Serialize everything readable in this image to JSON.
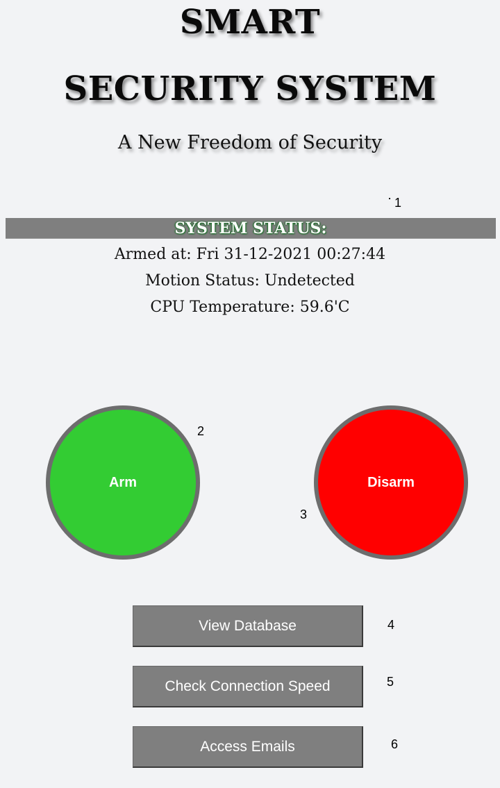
{
  "header": {
    "title_line1": "SMART",
    "title_line2": "SECURITY SYSTEM",
    "subtitle": "A New Freedom of Security"
  },
  "status": {
    "heading": "SYSTEM STATUS:",
    "armed": "Armed at: Fri 31-12-2021 00:27:44",
    "motion": "Motion Status: Undetected",
    "cpu_temperature": "CPU Temperature: 59.6'C"
  },
  "controls": {
    "arm_label": "Arm",
    "disarm_label": "Disarm",
    "arm_color": "#33cc33",
    "disarm_color": "#ff0000"
  },
  "actions": {
    "view_database": "View Database",
    "check_speed": "Check Connection Speed",
    "access_emails": "Access Emails"
  },
  "markers": {
    "m1": "1",
    "m2": "2",
    "m3": "3",
    "m4": "4",
    "m5": "5",
    "m6": "6"
  }
}
